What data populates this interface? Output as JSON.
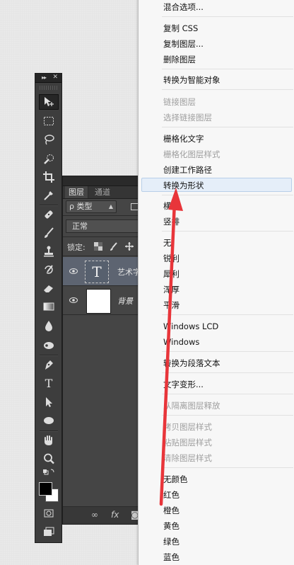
{
  "toolbar": {
    "collapse_icon": "double-chevron-icon",
    "close_icon": "close-icon",
    "tools": [
      {
        "name": "move-tool",
        "icon": "move-icon"
      },
      {
        "name": "marquee-tool",
        "icon": "rect-marquee-icon"
      },
      {
        "name": "lasso-tool",
        "icon": "lasso-icon"
      },
      {
        "name": "quick-select-tool",
        "icon": "quick-select-icon"
      },
      {
        "name": "crop-tool",
        "icon": "crop-icon"
      },
      {
        "name": "eyedropper-tool",
        "icon": "eyedropper-icon"
      },
      {
        "name": "healing-brush-tool",
        "icon": "bandage-icon"
      },
      {
        "name": "brush-tool",
        "icon": "brush-icon"
      },
      {
        "name": "clone-stamp-tool",
        "icon": "stamp-icon"
      },
      {
        "name": "history-brush-tool",
        "icon": "history-brush-icon"
      },
      {
        "name": "eraser-tool",
        "icon": "eraser-icon"
      },
      {
        "name": "gradient-tool",
        "icon": "gradient-icon"
      },
      {
        "name": "blur-tool",
        "icon": "drop-icon"
      },
      {
        "name": "dodge-tool",
        "icon": "dodge-icon"
      },
      {
        "name": "pen-tool",
        "icon": "pen-icon"
      },
      {
        "name": "type-tool",
        "icon": "type-icon"
      },
      {
        "name": "path-select-tool",
        "icon": "arrow-select-icon"
      },
      {
        "name": "shape-tool",
        "icon": "ellipse-icon"
      },
      {
        "name": "hand-tool",
        "icon": "hand-icon"
      },
      {
        "name": "zoom-tool",
        "icon": "zoom-icon"
      }
    ],
    "foreground_color": "#000000",
    "background_color": "#ffffff"
  },
  "layers_panel": {
    "tabs": [
      "图层",
      "通道"
    ],
    "filter_label": "ρ 类型",
    "blend_mode": "正常",
    "lock_label": "锁定:",
    "layers": [
      {
        "name": "艺术字",
        "thumb": "T",
        "selected": true
      },
      {
        "name": "背景",
        "thumb": "",
        "selected": false
      }
    ],
    "footer": {
      "link": "∞",
      "fx": "fx"
    }
  },
  "context_menu": {
    "items": [
      {
        "label": "混合选项...",
        "disabled": false
      },
      {
        "label": "复制 CSS",
        "disabled": false
      },
      {
        "label": "复制图层...",
        "disabled": false
      },
      {
        "label": "删除图层",
        "disabled": false
      },
      {
        "label": "转换为智能对象",
        "disabled": false
      },
      {
        "label": "链接图层",
        "disabled": true
      },
      {
        "label": "选择链接图层",
        "disabled": true
      },
      {
        "label": "栅格化文字",
        "disabled": false
      },
      {
        "label": "栅格化图层样式",
        "disabled": true
      },
      {
        "label": "创建工作路径",
        "disabled": false
      },
      {
        "label": "转换为形状",
        "disabled": false,
        "highlighted": true
      },
      {
        "label": "横排",
        "disabled": false
      },
      {
        "label": "竖排",
        "disabled": false
      },
      {
        "label": "无",
        "disabled": false
      },
      {
        "label": "锐利",
        "disabled": false
      },
      {
        "label": "犀利",
        "disabled": false
      },
      {
        "label": "浑厚",
        "disabled": false
      },
      {
        "label": "平滑",
        "disabled": false
      },
      {
        "label": "Windows LCD",
        "disabled": false
      },
      {
        "label": "Windows",
        "disabled": false
      },
      {
        "label": "转换为段落文本",
        "disabled": false
      },
      {
        "label": "文字变形...",
        "disabled": false
      },
      {
        "label": "从隔离图层释放",
        "disabled": true
      },
      {
        "label": "拷贝图层样式",
        "disabled": true
      },
      {
        "label": "粘贴图层样式",
        "disabled": true
      },
      {
        "label": "清除图层样式",
        "disabled": true
      },
      {
        "label": "无颜色",
        "disabled": false
      },
      {
        "label": "红色",
        "disabled": false
      },
      {
        "label": "橙色",
        "disabled": false
      },
      {
        "label": "黄色",
        "disabled": false
      },
      {
        "label": "绿色",
        "disabled": false
      },
      {
        "label": "蓝色",
        "disabled": false
      }
    ]
  },
  "annotation": {
    "arrow_color": "#e8353a"
  }
}
